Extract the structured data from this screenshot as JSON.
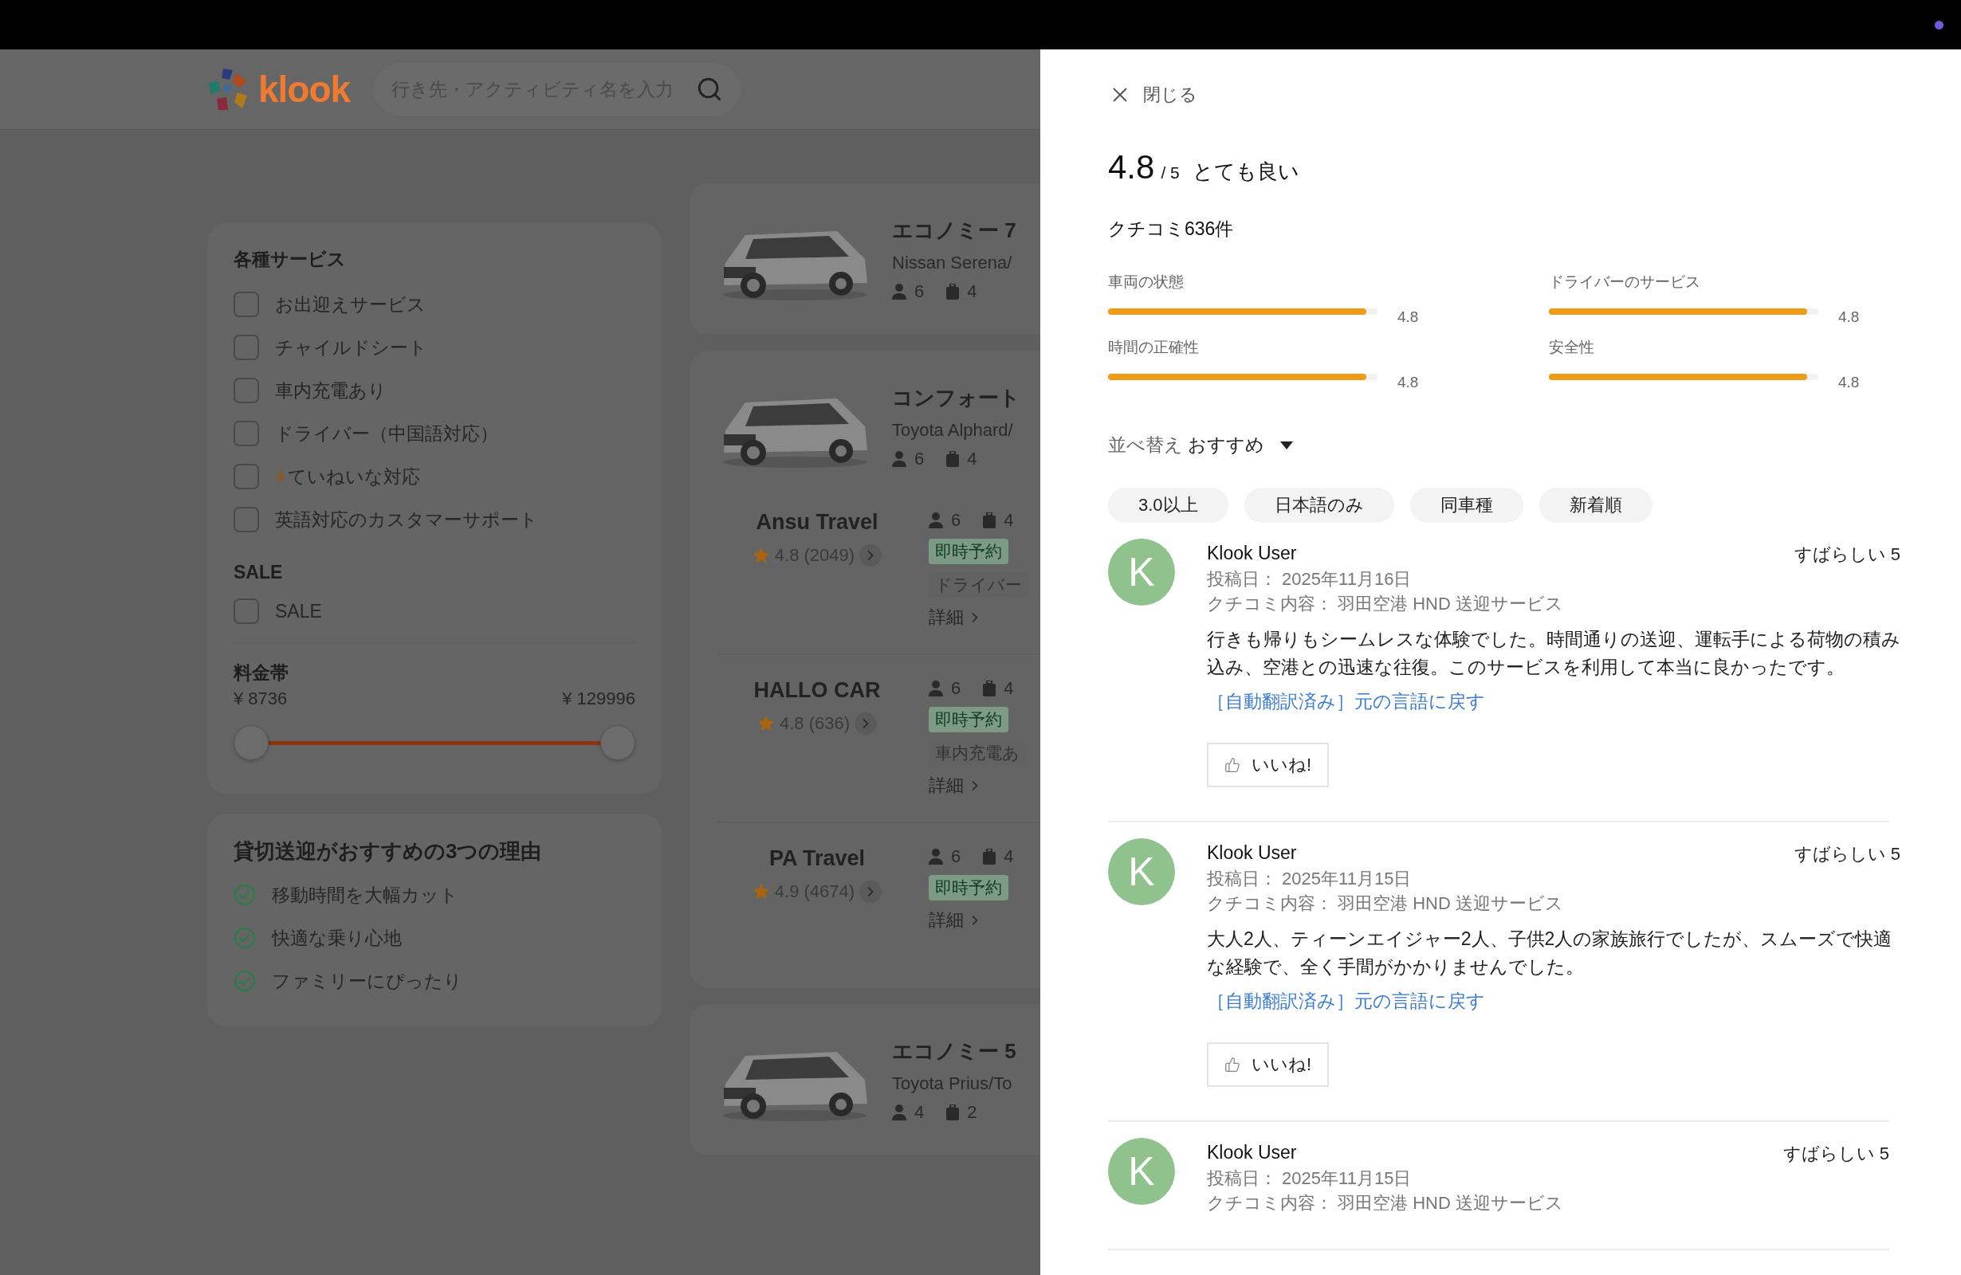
{
  "header": {
    "logo": "klook",
    "search": {
      "placeholder": "行き先・アクティビティ名を入力"
    }
  },
  "filters": {
    "services": {
      "title": "各種サービス",
      "options": [
        {
          "label": "お出迎えサービス",
          "checked": false,
          "kind": "plain"
        },
        {
          "label": "チャイルドシート",
          "checked": false,
          "kind": "plain"
        },
        {
          "label": "車内充電あり",
          "checked": false,
          "kind": "plain"
        },
        {
          "label": "ドライバー（中国語対応）",
          "checked": false,
          "kind": "plain"
        },
        {
          "label": "ていねいな対応",
          "checked": false,
          "kind": "lightning"
        },
        {
          "label": "英語対応のカスタマーサポート",
          "checked": false,
          "kind": "plain"
        }
      ]
    },
    "sale": {
      "title": "SALE",
      "options": [
        {
          "label": "SALE",
          "checked": false
        }
      ]
    },
    "price": {
      "title": "料金帯",
      "min": "¥ 8736",
      "max": "¥ 129996",
      "thumbs": [
        {
          "level": 0
        },
        {
          "level": 1
        }
      ]
    }
  },
  "reasons": {
    "title": "貸切送迎がおすすめの3つの理由",
    "items": [
      "移動時間を大幅カット",
      "快適な乗り心地",
      "ファミリーにぴったり"
    ]
  },
  "vehicles": [
    {
      "title": "エコノミー 7",
      "model": "Nissan Serena/",
      "passengers": "6",
      "luggage": "4"
    },
    {
      "title": "コンフォート",
      "model": "Toyota Alphard/",
      "passengers": "6",
      "luggage": "4",
      "suppliers": [
        {
          "name": "Ansu Travel",
          "rating": "4.8 (2049)",
          "passengers": "6",
          "luggage": "4",
          "tags": [
            "即時予約"
          ],
          "features": [
            "ドライバー"
          ],
          "details": "詳細"
        },
        {
          "name": "HALLO CAR",
          "rating": "4.8 (636)",
          "passengers": "6",
          "luggage": "4",
          "tags": [
            "即時予約"
          ],
          "features": [
            "車内充電あ"
          ],
          "details": "詳細"
        },
        {
          "name": "PA Travel",
          "rating": "4.9 (4674)",
          "passengers": "6",
          "luggage": "4",
          "tags": [
            "即時予約"
          ],
          "details": "詳細"
        }
      ]
    },
    {
      "title": "エコノミー 5",
      "model": "Toyota Prius/To",
      "passengers": "4",
      "luggage": "2"
    }
  ],
  "drawer": {
    "close": "閉じる",
    "score": "4.8",
    "out_of": "/ 5",
    "verdict": "とても良い",
    "count": "クチコミ636件",
    "aspects": [
      {
        "label": "車両の状態",
        "value": "4.8",
        "level": 0.96
      },
      {
        "label": "ドライバーのサービス",
        "value": "4.8",
        "level": 0.96
      },
      {
        "label": "時間の正確性",
        "value": "4.8",
        "level": 0.96
      },
      {
        "label": "安全性",
        "value": "4.8",
        "level": 0.96
      }
    ],
    "sort": {
      "label": "並べ替え",
      "value": "おすすめ"
    },
    "chips": [
      "3.0以上",
      "日本語のみ",
      "同車種",
      "新着順"
    ],
    "reviews": [
      {
        "initial": "K",
        "name": "Klook User",
        "rating": "すばらしい 5",
        "date": "投稿日： 2025年11月16日",
        "subject": "クチコミ内容： 羽田空港 HND 送迎サービス",
        "body": "行きも帰りもシームレスな体験でした。時間通りの送迎、運転手による荷物の積み込み、空港との迅速な往復。このサービスを利用して本当に良かったです。",
        "translation": "［自動翻訳済み］元の言語に戻す",
        "like": "いいね!"
      },
      {
        "initial": "K",
        "name": "Klook User",
        "rating": "すばらしい 5",
        "date": "投稿日： 2025年11月15日",
        "subject": "クチコミ内容： 羽田空港 HND 送迎サービス",
        "body": "大人2人、ティーンエイジャー2人、子供2人の家族旅行でしたが、スムーズで快適な経験で、全く手間がかかりませんでした。",
        "translation": "［自動翻訳済み］元の言語に戻す",
        "like": "いいね!"
      },
      {
        "initial": "K",
        "name": "Klook User",
        "rating": "すばらしい 5",
        "date": "投稿日： 2025年11月15日",
        "subject": "クチコミ内容： 羽田空港 HND 送迎サービス"
      }
    ]
  }
}
